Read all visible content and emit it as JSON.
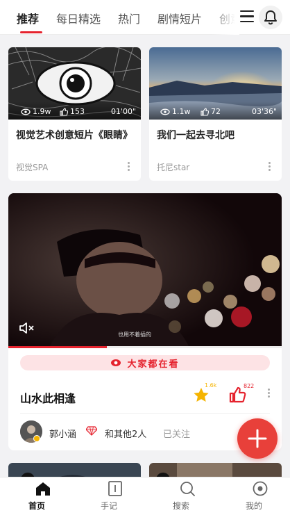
{
  "top_tabs": [
    {
      "label": "推荐",
      "active": true
    },
    {
      "label": "每日精选",
      "active": false
    },
    {
      "label": "热门",
      "active": false
    },
    {
      "label": "剧情短片",
      "active": false
    },
    {
      "label": "创意",
      "active": false
    }
  ],
  "header_icons": [
    "menu-icon",
    "bell-icon"
  ],
  "cards": [
    {
      "title": "视觉艺术创意短片《眼睛》",
      "views": "1.9w",
      "likes": "153",
      "duration": "01'00\"",
      "author": "视觉SPA"
    },
    {
      "title": "我们一起去寻北吧",
      "views": "1.1w",
      "likes": "72",
      "duration": "03'36\"",
      "author": "托尼star"
    }
  ],
  "featured": {
    "badge": "大家都在看",
    "title": "山水此相逢",
    "favorite_count": "1.6k",
    "like_count": "822",
    "subtitle_overlay": "也用不着插的",
    "progress": 0.36,
    "author_name": "郭小涵",
    "others": "和其他2人",
    "follow_status": "已关注"
  },
  "bottom_nav": [
    {
      "label": "首页",
      "icon": "home-icon",
      "active": true
    },
    {
      "label": "手记",
      "icon": "notebook-icon",
      "active": false
    },
    {
      "label": "搜索",
      "icon": "search-icon",
      "active": false
    },
    {
      "label": "我的",
      "icon": "profile-icon",
      "active": false
    }
  ],
  "colors": {
    "accent": "#e5232e",
    "fab": "#e8403a",
    "star": "#f5b400",
    "badge_bg": "#fde3e5"
  }
}
